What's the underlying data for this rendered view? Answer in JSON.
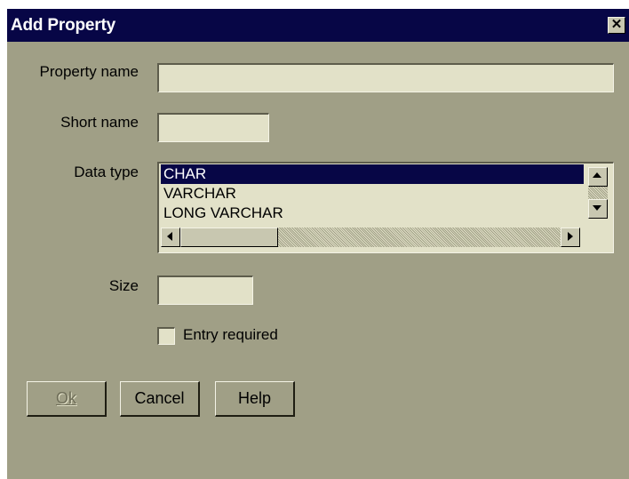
{
  "dialog": {
    "title": "Add Property",
    "close_glyph": "✕"
  },
  "form": {
    "property_name_label": "Property name",
    "property_name_value": "",
    "short_name_label": "Short name",
    "short_name_value": "",
    "data_type_label": "Data type",
    "data_type_options": [
      "CHAR",
      "VARCHAR",
      "LONG VARCHAR"
    ],
    "data_type_selected": "CHAR",
    "size_label": "Size",
    "size_value": "",
    "entry_required_label": "Entry required",
    "entry_required_checked": false
  },
  "buttons": {
    "ok_label": "Ok",
    "cancel_label": "Cancel",
    "help_label": "Help"
  },
  "icons": {
    "close": "close-icon",
    "scroll_up": "arrow-up-icon",
    "scroll_down": "arrow-down-icon",
    "scroll_left": "arrow-left-icon",
    "scroll_right": "arrow-right-icon"
  },
  "colors": {
    "dialog_bg": "#a09f86",
    "titlebar_bg": "#070646",
    "selection_bg": "#070646",
    "field_bg": "#e2e1c8"
  }
}
